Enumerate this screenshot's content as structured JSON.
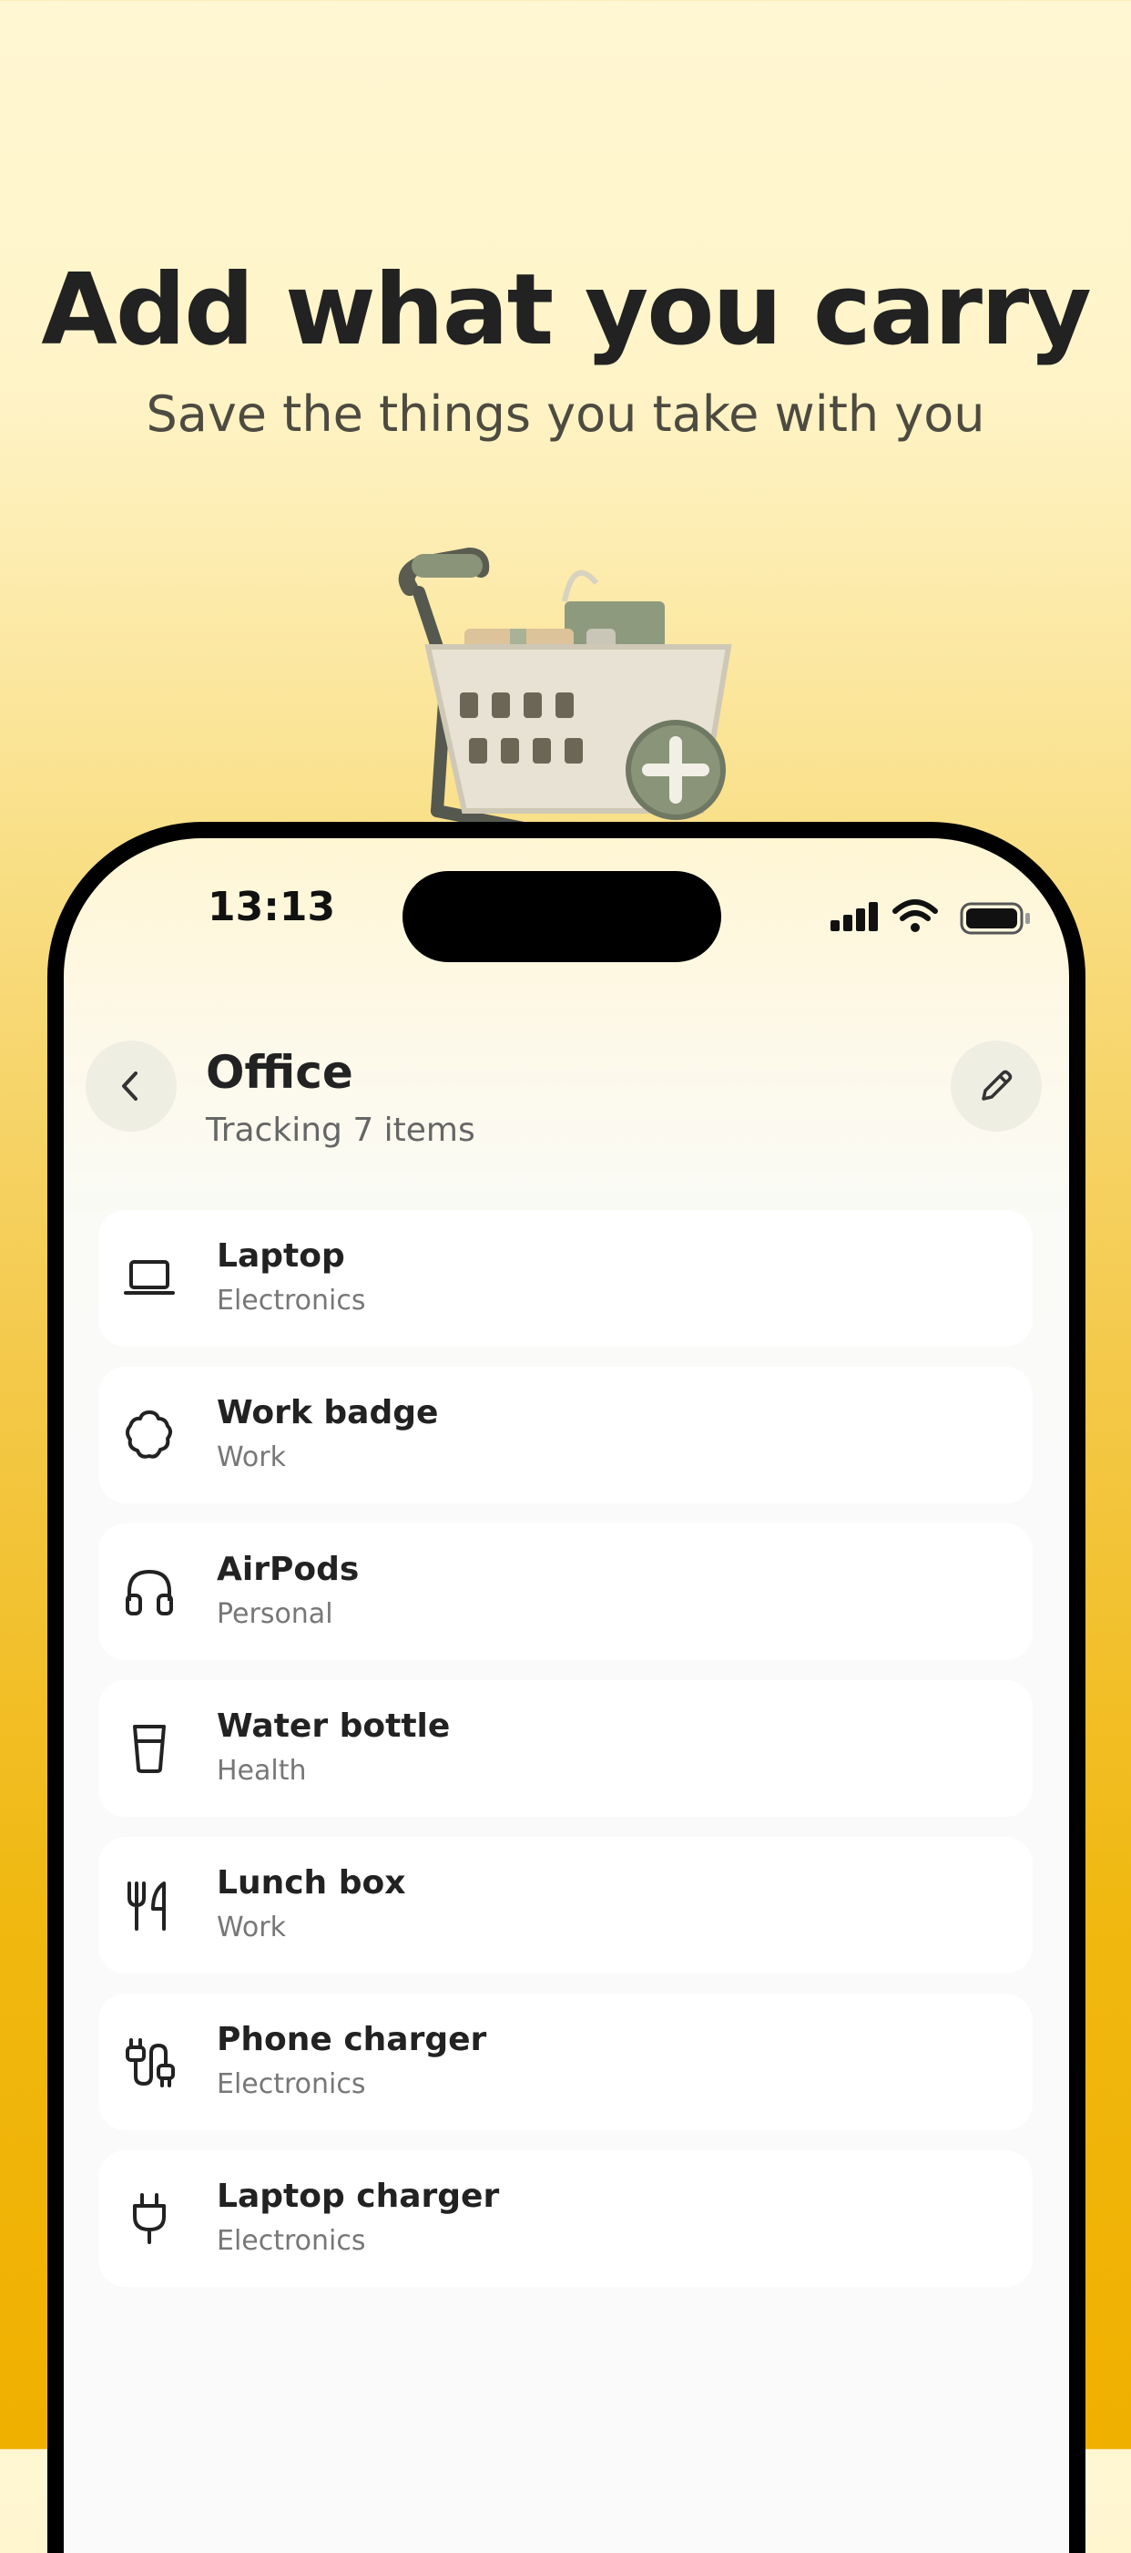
{
  "hero": {
    "headline": "Add what you carry",
    "subheadline": "Save the things you take with you"
  },
  "status_bar": {
    "time": "13:13"
  },
  "header": {
    "title": "Office",
    "subtitle": "Tracking 7 items",
    "back_icon": "chevron-left-icon",
    "edit_icon": "pencil-icon"
  },
  "items": [
    {
      "name": "Laptop",
      "category": "Electronics",
      "icon": "laptop-icon"
    },
    {
      "name": "Work badge",
      "category": "Work",
      "icon": "badge-icon"
    },
    {
      "name": "AirPods",
      "category": "Personal",
      "icon": "headphones-icon"
    },
    {
      "name": "Water bottle",
      "category": "Health",
      "icon": "cup-icon"
    },
    {
      "name": "Lunch box",
      "category": "Work",
      "icon": "utensils-icon"
    },
    {
      "name": "Phone charger",
      "category": "Electronics",
      "icon": "cable-icon"
    },
    {
      "name": "Laptop charger",
      "category": "Electronics",
      "icon": "plug-icon"
    }
  ],
  "colors": {
    "accent": "#f0b000",
    "card": "#ffffff",
    "text": "#222222",
    "muted": "#777777"
  }
}
